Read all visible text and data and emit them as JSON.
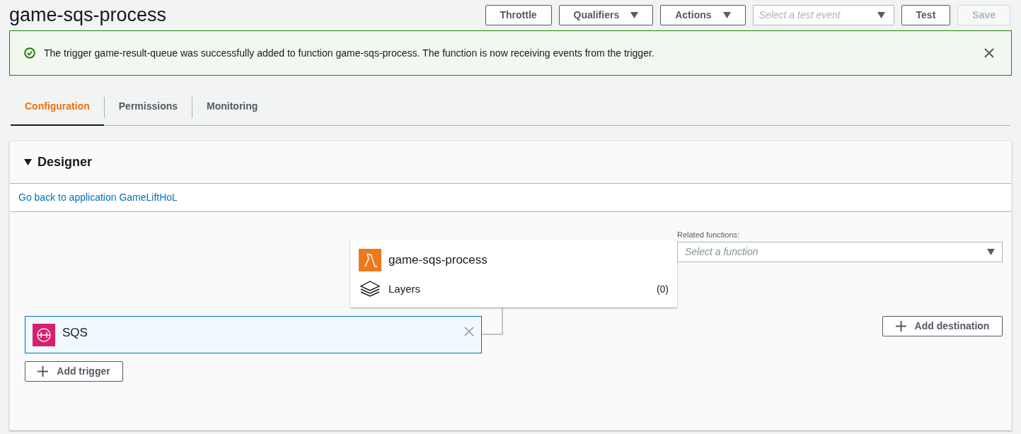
{
  "header": {
    "title": "game-sqs-process",
    "buttons": [
      {
        "label": "Throttle",
        "kind": "button",
        "disabled": false
      },
      {
        "label": "Qualifiers",
        "kind": "menu",
        "disabled": false
      },
      {
        "label": "Actions",
        "kind": "menu",
        "disabled": false
      },
      {
        "placeholder": "Select a test event",
        "kind": "select",
        "disabled": false
      },
      {
        "label": "Test",
        "kind": "button",
        "disabled": false
      },
      {
        "label": "Save",
        "kind": "button",
        "disabled": true
      }
    ]
  },
  "banner": {
    "message": "The trigger game-result-queue was successfully added to function game-sqs-process. The function is now receiving events from the trigger."
  },
  "tabs": [
    {
      "label": "Configuration",
      "selected": true
    },
    {
      "label": "Permissions",
      "selected": false
    },
    {
      "label": "Monitoring",
      "selected": false
    }
  ],
  "designer": {
    "title": "Designer",
    "expanded": true,
    "link": "Go back to application GameLiftHoL",
    "function": {
      "name": "game-sqs-process",
      "layers_label": "Layers",
      "layers_count": "(0)"
    },
    "related_label": "Related functions:",
    "related_placeholder": "Select a function",
    "trigger": {
      "name": "SQS"
    },
    "add_trigger": "Add trigger",
    "add_destination": "Add destination"
  }
}
